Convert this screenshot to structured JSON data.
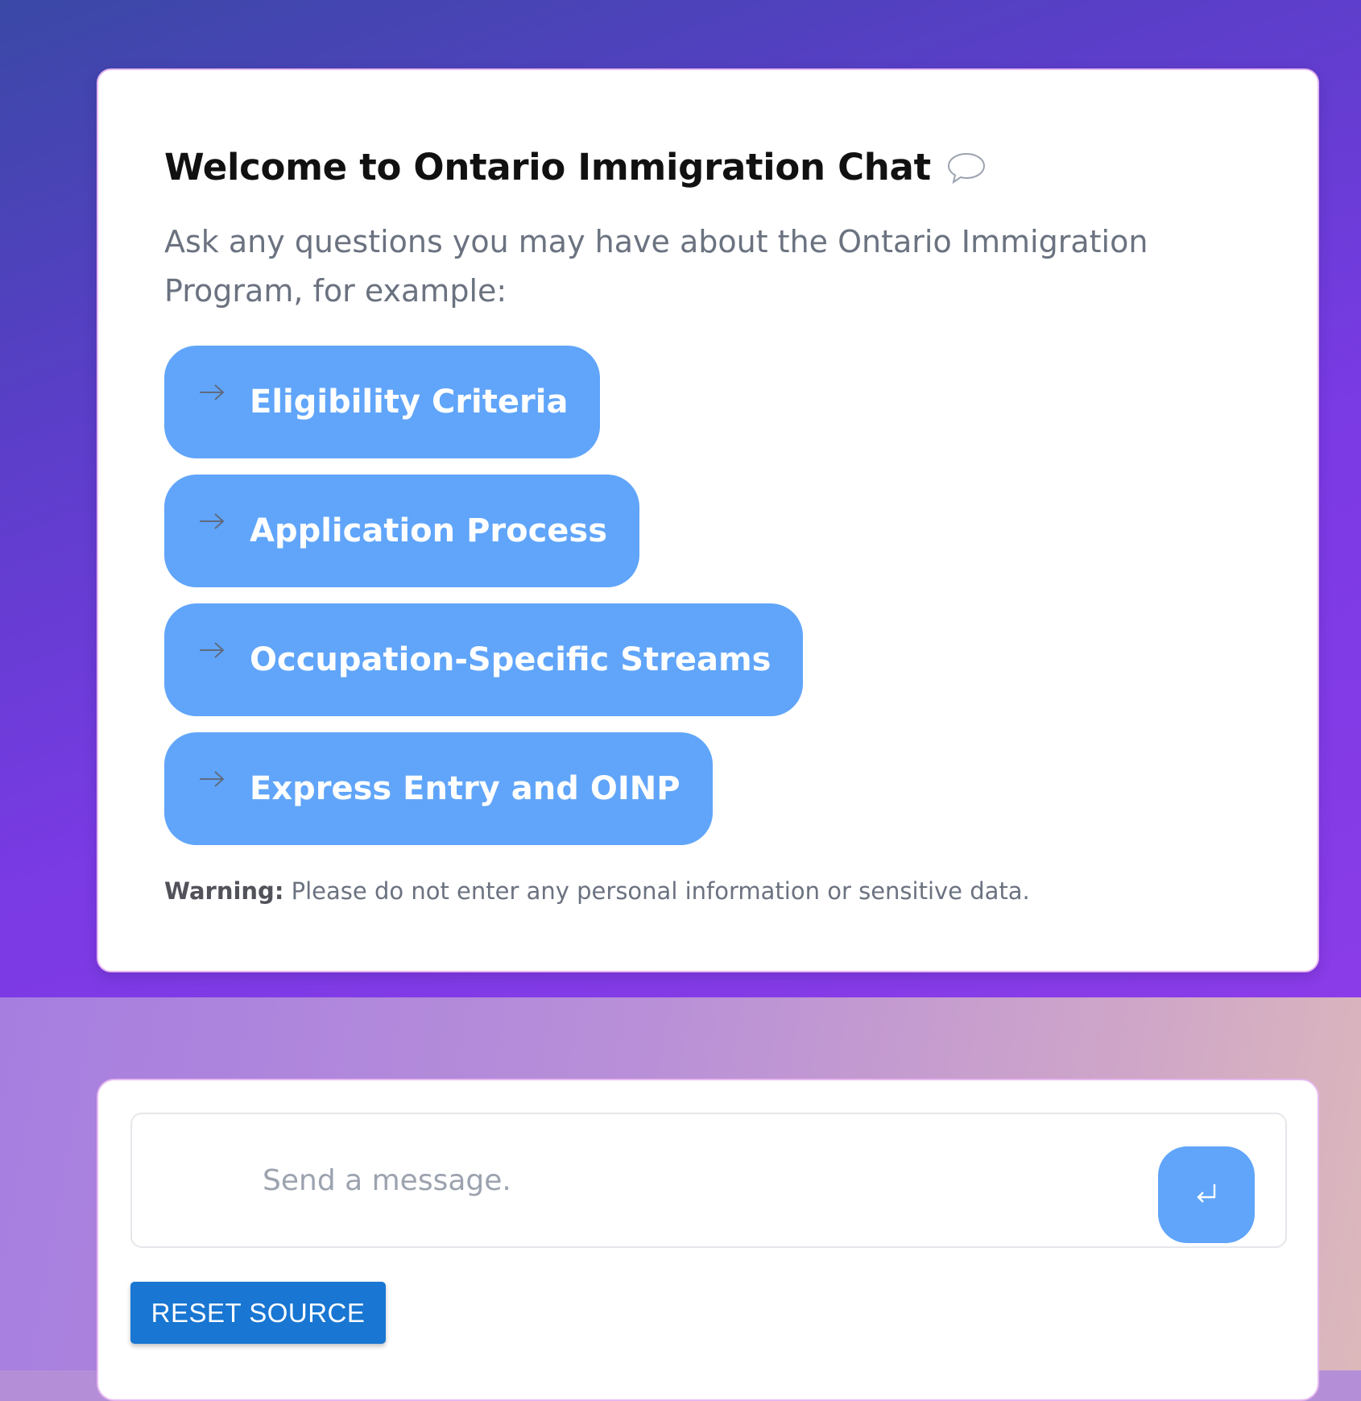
{
  "welcome": {
    "title": "Welcome to Ontario Immigration Chat",
    "title_icon": "speech-bubble-icon",
    "intro": "Ask any questions you may have about the Ontario Immigration Program, for example:",
    "suggestions": [
      {
        "label": "Eligibility Criteria",
        "icon": "arrow-right-icon"
      },
      {
        "label": "Application Process",
        "icon": "arrow-right-icon"
      },
      {
        "label": "Occupation-Specific Streams",
        "icon": "arrow-right-icon"
      },
      {
        "label": "Express Entry and OINP",
        "icon": "arrow-right-icon"
      }
    ],
    "warning_label": "Warning:",
    "warning_text": " Please do not enter any personal information or sensitive data."
  },
  "composer": {
    "placeholder": "Send a message.",
    "value": "",
    "send_icon": "enter-return-icon",
    "reset_label": "RESET SOURCE"
  },
  "colors": {
    "suggestion_bg": "#60a5fa",
    "send_bg": "#60a5fa",
    "reset_bg": "#1976d2",
    "muted_text": "#6b7280"
  }
}
